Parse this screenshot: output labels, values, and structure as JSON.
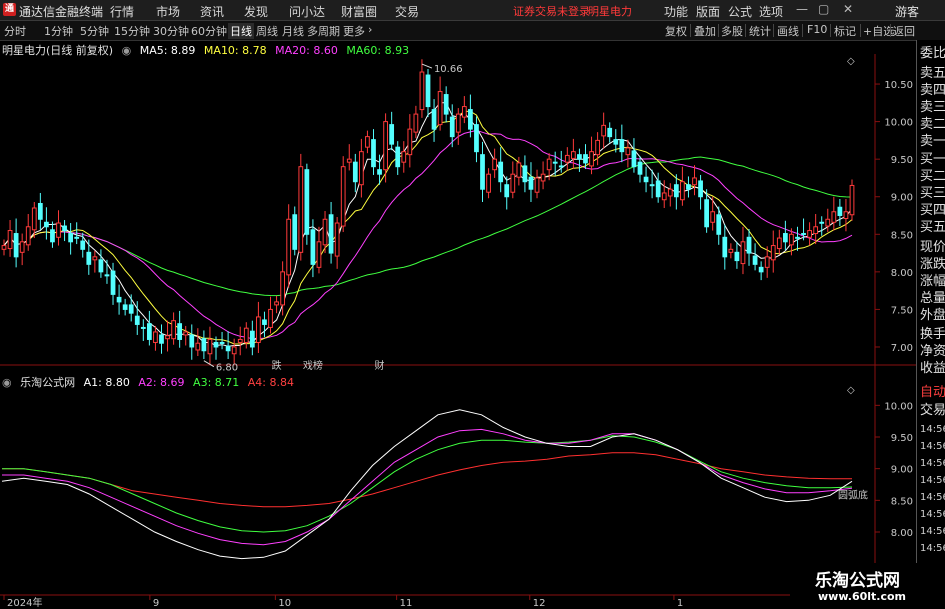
{
  "menubar": {
    "app_title": "通达信金融终端",
    "items": [
      "行情",
      "市场",
      "资讯",
      "发现",
      "问小达",
      "财富圈",
      "交易"
    ],
    "warning": "证券交易未登录",
    "stock_name": "明星电力",
    "right_items": [
      "功能",
      "版面",
      "公式",
      "选项"
    ],
    "guest": "游客"
  },
  "toolbar": {
    "periods": [
      "分时",
      "1分钟",
      "5分钟",
      "15分钟",
      "30分钟",
      "60分钟",
      "日线",
      "周线",
      "月线",
      "多周期",
      "更多"
    ],
    "active_period": "日线",
    "right_buttons": [
      "复权",
      "叠加",
      "多股",
      "统计",
      "画线",
      "F10",
      "标记",
      "+自选",
      "返回"
    ]
  },
  "main_chart": {
    "title": "明星电力(日线 前复权)",
    "ma_labels": [
      {
        "label": "MA5: 8.89",
        "color": "#ffffff"
      },
      {
        "label": "MA10: 8.78",
        "color": "#ffff40"
      },
      {
        "label": "MA20: 8.60",
        "color": "#ff40ff"
      },
      {
        "label": "MA60: 8.93",
        "color": "#40ff40"
      }
    ],
    "high_label": "10.66",
    "low_label": "6.80",
    "markers": [
      {
        "text": "跌",
        "color": "#40ff40"
      },
      {
        "text": "戏榜",
        "color": "#ff4040"
      },
      {
        "text": "财",
        "color": "#6aa8ff"
      }
    ]
  },
  "sub_chart": {
    "title": "乐淘公式网",
    "labels": [
      {
        "label": "A1: 8.80",
        "color": "#ffffff"
      },
      {
        "label": "A2: 8.69",
        "color": "#ff40ff"
      },
      {
        "label": "A3: 8.71",
        "color": "#40ff40"
      },
      {
        "label": "A4: 8.84",
        "color": "#ff4040"
      }
    ],
    "annotation": "圆弧底"
  },
  "x_axis_labels": [
    "2024年",
    "9",
    "10",
    "11",
    "12",
    "1"
  ],
  "right_panel": {
    "items": [
      "委比",
      "卖五",
      "卖四",
      "卖三",
      "卖二",
      "卖一",
      "买一",
      "买二",
      "买三",
      "买四",
      "买五",
      "现价",
      "涨跌",
      "涨幅",
      "总量",
      "外盘",
      "换手",
      "净资",
      "收益"
    ],
    "auto_label": "自动",
    "trade_label": "交易",
    "times": [
      "14:56",
      "14:56",
      "14:56",
      "14:56",
      "14:56",
      "14:56",
      "14:56",
      "14:56"
    ]
  },
  "watermark": {
    "title": "乐淘公式网",
    "url": "www.60lt.com"
  },
  "colors": {
    "up": "#ff3b3b",
    "down": "#54ffff",
    "ma5": "#ffffff",
    "ma10": "#ffff40",
    "ma20": "#ff40ff",
    "ma60": "#40ff40"
  },
  "chart_data": [
    {
      "type": "candlestick",
      "title": "明星电力(日线 前复权)",
      "ylim": [
        6.8,
        10.9
      ],
      "y_ticks": [
        7.0,
        7.5,
        8.0,
        8.5,
        9.0,
        9.5,
        10.0,
        10.5
      ],
      "x_labels": [
        "2024年",
        "9",
        "10",
        "11",
        "12",
        "1"
      ],
      "close": [
        8.35,
        8.55,
        8.2,
        8.4,
        8.6,
        8.85,
        8.7,
        8.6,
        8.4,
        8.65,
        8.55,
        8.4,
        8.45,
        8.3,
        8.1,
        8.2,
        8.0,
        7.95,
        7.7,
        7.6,
        7.5,
        7.45,
        7.3,
        7.25,
        7.1,
        7.2,
        7.05,
        7.15,
        7.35,
        7.1,
        7.2,
        7.0,
        7.05,
        6.95,
        7.1,
        7.0,
        7.05,
        6.95,
        7.0,
        7.1,
        7.25,
        7.0,
        7.4,
        7.3,
        7.5,
        7.6,
        8.0,
        8.7,
        8.3,
        9.4,
        8.5,
        8.1,
        8.4,
        8.7,
        8.25,
        8.65,
        9.4,
        9.5,
        9.2,
        9.6,
        9.8,
        9.4,
        9.3,
        10.0,
        9.7,
        9.4,
        9.6,
        9.9,
        10.1,
        10.66,
        10.2,
        9.9,
        10.4,
        10.1,
        9.8,
        10.1,
        10.2,
        9.9,
        9.6,
        9.1,
        9.3,
        9.5,
        9.2,
        9.0,
        9.3,
        9.45,
        9.2,
        9.1,
        9.25,
        9.3,
        9.5,
        9.45,
        9.4,
        9.55,
        9.6,
        9.5,
        9.45,
        9.6,
        9.75,
        9.95,
        9.8,
        9.7,
        9.6,
        9.65,
        9.4,
        9.3,
        9.2,
        9.15,
        9.0,
        9.05,
        9.1,
        9.0,
        9.2,
        9.1,
        9.25,
        9.0,
        8.6,
        8.8,
        8.5,
        8.2,
        8.3,
        8.15,
        8.4,
        8.25,
        8.1,
        8.0,
        8.2,
        8.35,
        8.45,
        8.4,
        8.5,
        8.45,
        8.5,
        8.55,
        8.6,
        8.65,
        8.7,
        8.8,
        8.75,
        8.8,
        9.15
      ]
    },
    {
      "type": "line",
      "title": "乐淘公式网",
      "ylim": [
        7.4,
        10.4
      ],
      "y_ticks": [
        8.0,
        8.5,
        9.0,
        9.5,
        10.0
      ],
      "series": [
        {
          "name": "A1",
          "values": [
            8.8,
            8.85,
            8.8,
            8.75,
            8.6,
            8.4,
            8.2,
            8.0,
            7.85,
            7.72,
            7.62,
            7.58,
            7.6,
            7.7,
            7.95,
            8.2,
            8.65,
            9.05,
            9.35,
            9.6,
            9.85,
            9.93,
            9.85,
            9.65,
            9.5,
            9.4,
            9.35,
            9.35,
            9.5,
            9.55,
            9.45,
            9.3,
            9.1,
            8.85,
            8.7,
            8.55,
            8.48,
            8.5,
            8.58,
            8.8
          ]
        },
        {
          "name": "A2",
          "values": [
            8.9,
            8.9,
            8.85,
            8.8,
            8.7,
            8.55,
            8.4,
            8.25,
            8.1,
            7.98,
            7.88,
            7.82,
            7.8,
            7.85,
            8.0,
            8.2,
            8.5,
            8.8,
            9.1,
            9.3,
            9.5,
            9.6,
            9.62,
            9.55,
            9.45,
            9.4,
            9.4,
            9.45,
            9.55,
            9.55,
            9.45,
            9.3,
            9.1,
            8.9,
            8.78,
            8.68,
            8.62,
            8.62,
            8.65,
            8.69
          ]
        },
        {
          "name": "A3",
          "values": [
            9.0,
            9.0,
            8.95,
            8.9,
            8.85,
            8.75,
            8.6,
            8.45,
            8.3,
            8.18,
            8.08,
            8.02,
            8.0,
            8.02,
            8.1,
            8.25,
            8.45,
            8.7,
            8.95,
            9.15,
            9.3,
            9.4,
            9.45,
            9.45,
            9.42,
            9.4,
            9.42,
            9.45,
            9.52,
            9.5,
            9.42,
            9.3,
            9.12,
            8.95,
            8.85,
            8.78,
            8.73,
            8.7,
            8.7,
            8.71
          ]
        },
        {
          "name": "A4",
          "values": [
            9.0,
            9.0,
            8.95,
            8.9,
            8.85,
            8.75,
            8.65,
            8.6,
            8.55,
            8.5,
            8.45,
            8.42,
            8.4,
            8.4,
            8.42,
            8.45,
            8.52,
            8.6,
            8.7,
            8.8,
            8.9,
            8.98,
            9.05,
            9.1,
            9.12,
            9.15,
            9.2,
            9.22,
            9.25,
            9.25,
            9.22,
            9.15,
            9.08,
            9.0,
            8.95,
            8.9,
            8.87,
            8.85,
            8.84,
            8.84
          ]
        }
      ]
    }
  ]
}
